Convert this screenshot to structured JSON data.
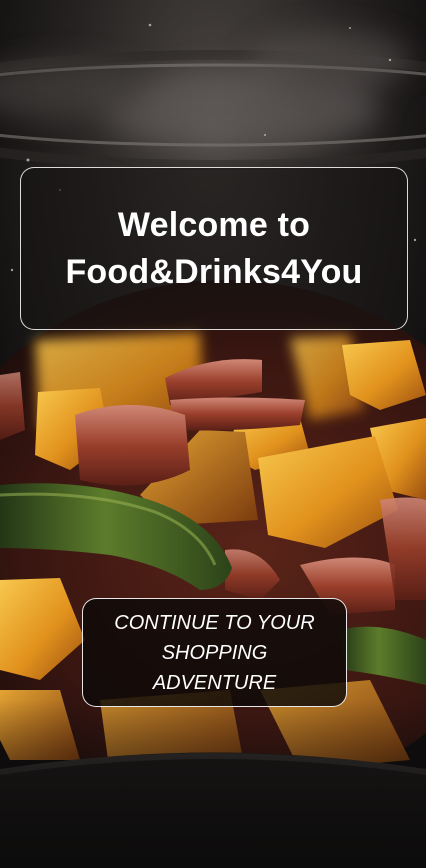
{
  "screen": {
    "background_image": "steaming-stir-fry-photo",
    "accent_color": "#ffffff",
    "card_background": "#161414"
  },
  "welcome": {
    "title": "Welcome to Food&Drinks4You"
  },
  "cta": {
    "label": "CONTINUE TO YOUR SHOPPING ADVENTURE"
  }
}
